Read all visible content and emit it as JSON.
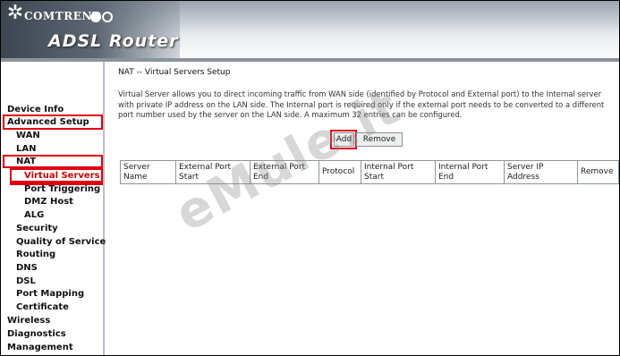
{
  "header": {
    "brand": "COMTREND",
    "product_title": "ADSL Router"
  },
  "sidebar": {
    "items": [
      {
        "label": "Device Info"
      },
      {
        "label": "Advanced Setup"
      },
      {
        "label": "WAN"
      },
      {
        "label": "LAN"
      },
      {
        "label": "NAT"
      },
      {
        "label": "Virtual Servers"
      },
      {
        "label": "Port Triggering"
      },
      {
        "label": "DMZ Host"
      },
      {
        "label": "ALG"
      },
      {
        "label": "Security"
      },
      {
        "label": "Quality of Service"
      },
      {
        "label": "Routing"
      },
      {
        "label": "DNS"
      },
      {
        "label": "DSL"
      },
      {
        "label": "Port Mapping"
      },
      {
        "label": "Certificate"
      },
      {
        "label": "Wireless"
      },
      {
        "label": "Diagnostics"
      },
      {
        "label": "Management"
      }
    ]
  },
  "main": {
    "title": "NAT -- Virtual Servers Setup",
    "description": "Virtual Server allows you to direct incoming traffic from WAN side (identified by Protocol and External port) to the Internal server with private IP address on the LAN side. The Internal port is required only if the external port needs to be converted to a different port number used by the server on the LAN side. A maximum 32 entries can be configured.",
    "add_label": "Add",
    "remove_label": "Remove",
    "table_headers": [
      "Server Name",
      "External Port Start",
      "External Port End",
      "Protocol",
      "Internal Port Start",
      "Internal Port End",
      "Server IP Address",
      "Remove"
    ]
  },
  "watermark": "eMule.it",
  "colors": {
    "highlight": "#e00010",
    "banner_dark": "#3d4650"
  }
}
